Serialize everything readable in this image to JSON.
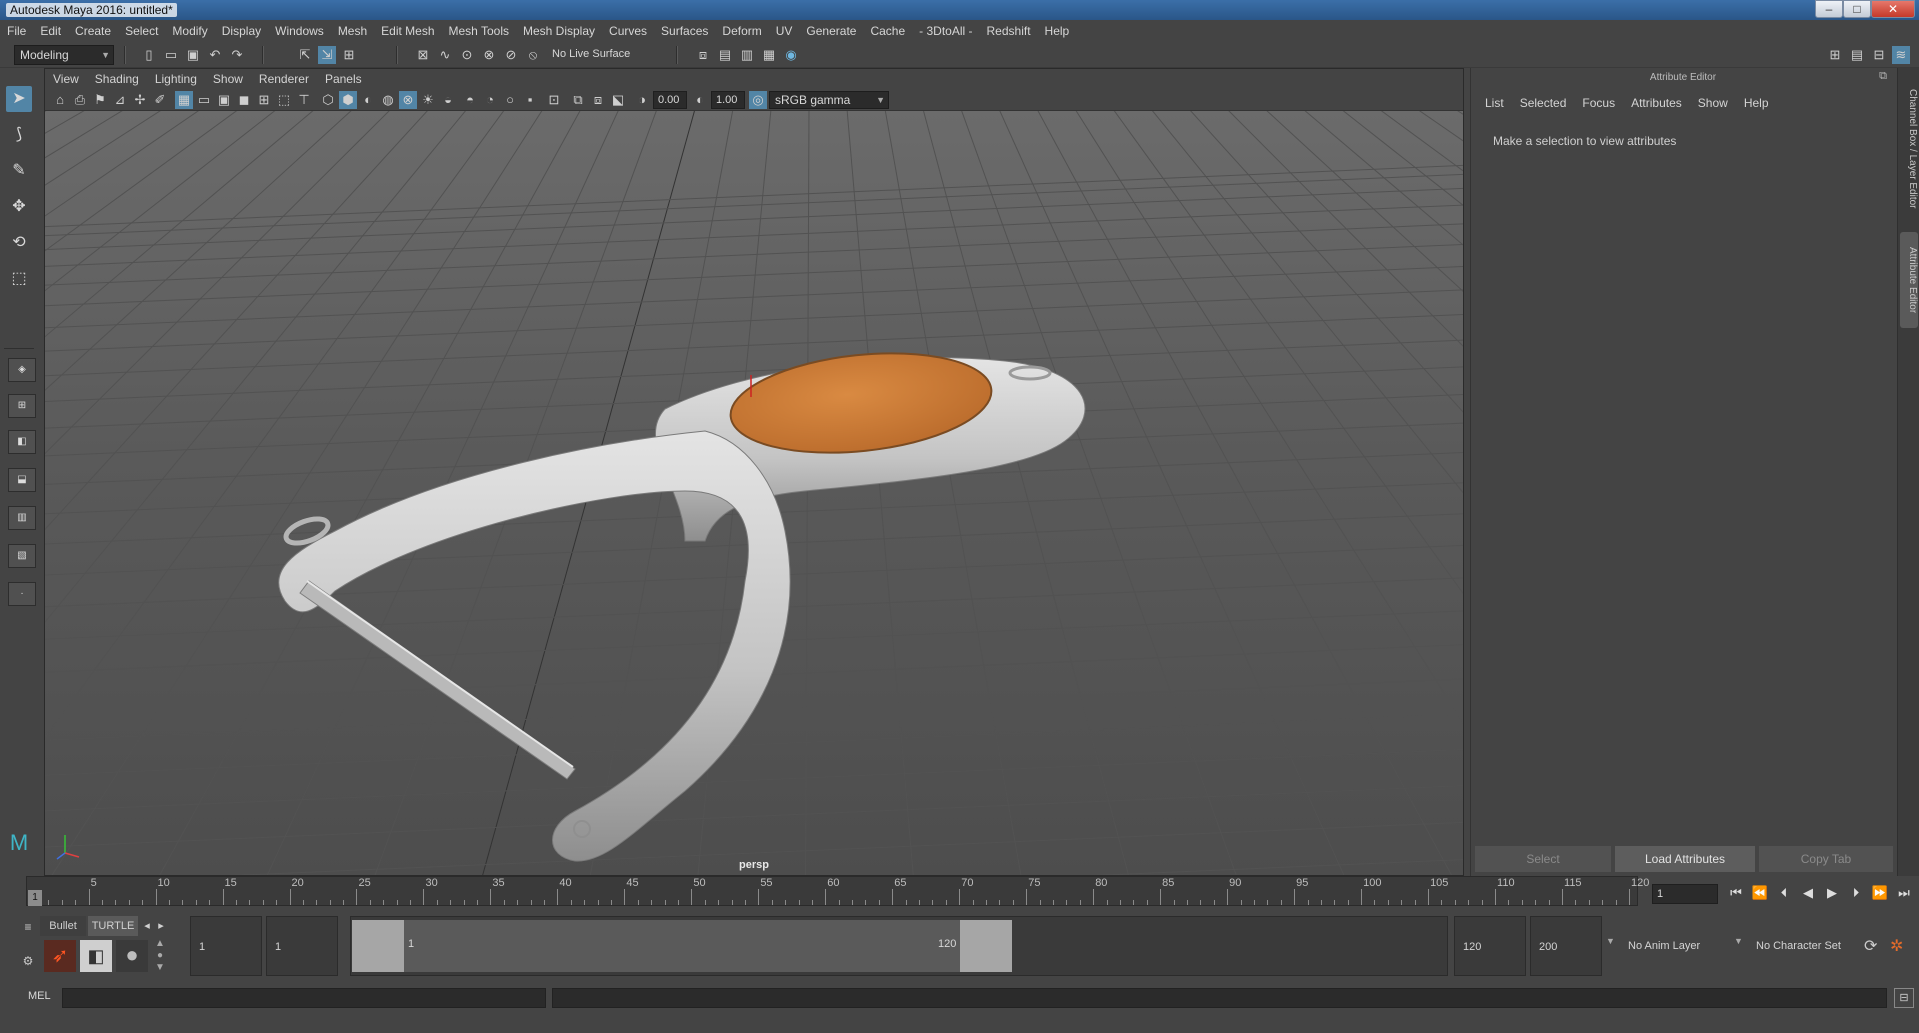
{
  "window": {
    "title": "Autodesk Maya 2016: untitled*",
    "minimize": "–",
    "maximize": "□",
    "close": "✕"
  },
  "menubar": [
    "File",
    "Edit",
    "Create",
    "Select",
    "Modify",
    "Display",
    "Windows",
    "Mesh",
    "Edit Mesh",
    "Mesh Tools",
    "Mesh Display",
    "Curves",
    "Surfaces",
    "Deform",
    "UV",
    "Generate",
    "Cache",
    "- 3DtoAll -",
    "Redshift",
    "Help"
  ],
  "statusline": {
    "mode": "Modeling",
    "live_surface": "No Live Surface"
  },
  "viewport": {
    "menu": [
      "View",
      "Shading",
      "Lighting",
      "Show",
      "Renderer",
      "Panels"
    ],
    "exposure": "0.00",
    "gamma": "1.00",
    "color_space": "sRGB gamma",
    "camera": "persp"
  },
  "attribute_editor": {
    "title": "Attribute Editor",
    "menu": [
      "List",
      "Selected",
      "Focus",
      "Attributes",
      "Show",
      "Help"
    ],
    "message": "Make a selection to view attributes",
    "buttons": {
      "select": "Select",
      "load": "Load Attributes",
      "copy": "Copy Tab"
    },
    "side_tabs": {
      "channel_box": "Channel Box / Layer Editor",
      "attribute_editor": "Attribute Editor"
    }
  },
  "timeslider": {
    "tick_labels": [
      "5",
      "10",
      "15",
      "20",
      "25",
      "30",
      "35",
      "40",
      "45",
      "50",
      "55",
      "60",
      "65",
      "70",
      "75",
      "80",
      "85",
      "90",
      "95",
      "100",
      "105",
      "110",
      "115",
      "120"
    ],
    "current_frame": "1",
    "current_frame_field": "1"
  },
  "rangeslider": {
    "shelf_tabs": [
      "Bullet",
      "TURTLE"
    ],
    "start_time": "1",
    "playback_start": "1",
    "range_start_label": "1",
    "range_end_label": "120",
    "playback_end": "120",
    "end_time": "200",
    "anim_layer": "No Anim Layer",
    "character_set": "No Character Set"
  },
  "commandline": {
    "language": "MEL"
  },
  "colors": {
    "accent": "#5285a6",
    "object_body": "#c9c9c9",
    "object_inlay": "#d27f35"
  }
}
